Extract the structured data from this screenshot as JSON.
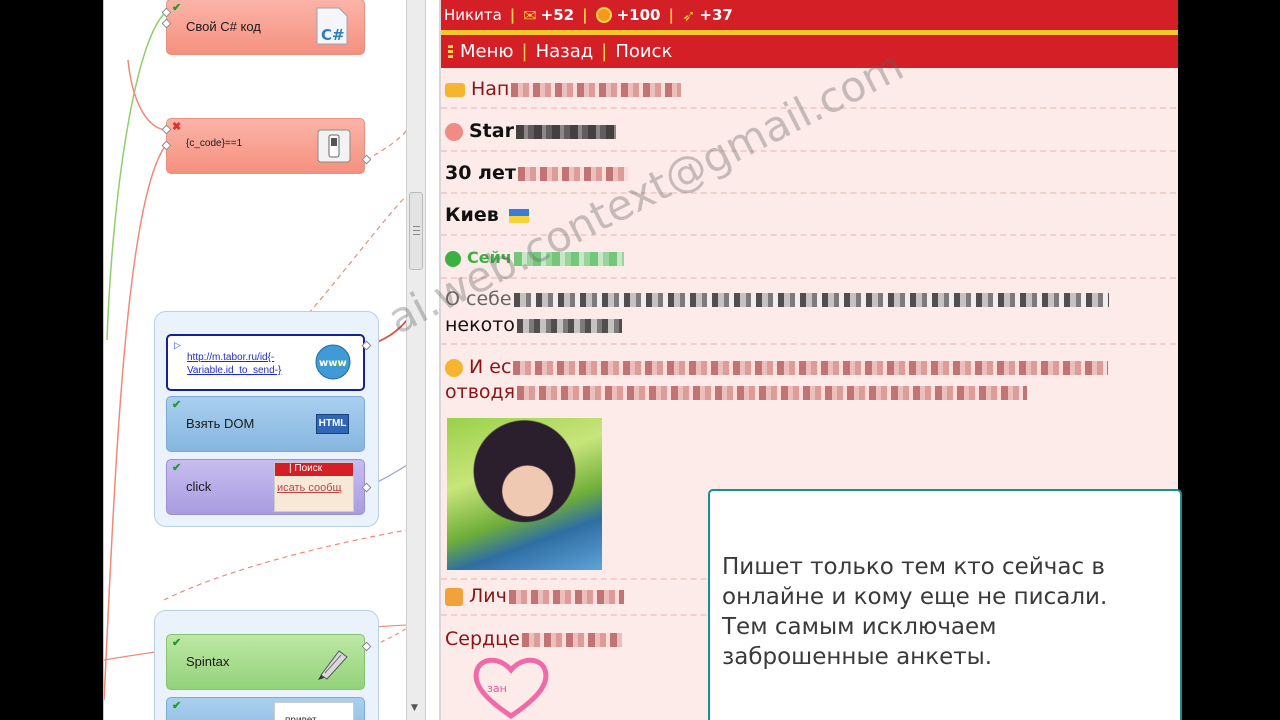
{
  "designer": {
    "nodes": {
      "csharp": {
        "label": "Свой C# код",
        "icon": "csharp-file-icon"
      },
      "condition": {
        "label": "{c_code}==1",
        "icon": "switch-icon"
      },
      "navigate": {
        "url_line1": "http://m.tabor.ru/id{-",
        "url_line2": "Variable.id_to_send-}",
        "icon": "www-globe-icon"
      },
      "get_dom": {
        "label": "Взять DOM",
        "icon_text": "HTML"
      },
      "click": {
        "label": "click",
        "thumb_line1": "| Поиск",
        "thumb_line2": "исать сообщ"
      },
      "spintax": {
        "label": "Spintax",
        "icon": "fountain-pen-icon"
      },
      "bottom": {
        "thumb_text": "привет"
      }
    },
    "colors": {
      "red_node": "#f5907f",
      "blue_node": "#86b6e0",
      "lilac_node": "#a99ce0",
      "green_node": "#93d27a",
      "wire_red": "#f08a78",
      "wire_green": "#8fcf6b"
    }
  },
  "site": {
    "topbar": {
      "user": "Никита",
      "mail_count": "+52",
      "coins_count": "+100",
      "rocket_count": "+37"
    },
    "nav": {
      "menu": "Меню",
      "back": "Назад",
      "search": "Поиск"
    },
    "profile": {
      "write": "Нап",
      "name": "Star",
      "age": "30 лет",
      "city": "Киев",
      "status": "Сейч",
      "about_label": "О себе",
      "about_cont": "некото",
      "wish": "И ес",
      "wish_cont": "отводя",
      "personal": "Лич",
      "heart": "Сердце",
      "heart_text": "зан"
    },
    "colors": {
      "red": "#d41f27",
      "gold": "#f6c72a",
      "bg": "#fcebe8",
      "link": "#8c1414"
    }
  },
  "watermark": "ai.web.context@gmail.com",
  "callout": {
    "line1": "Пишет только тем кто сейчас в",
    "line2": "онлайне и кому еще не писали.",
    "line3": "Тем самым исключаем",
    "line4": "заброшенные анкеты."
  }
}
